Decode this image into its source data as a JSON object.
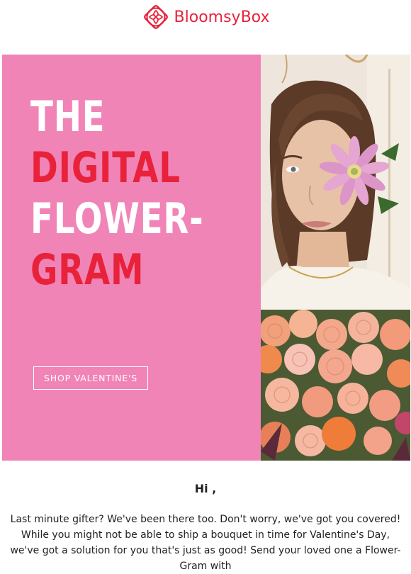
{
  "brand": {
    "name": "BloomsyBox",
    "logo_icon": "flower-knot-icon",
    "color": "#e8223a"
  },
  "hero": {
    "headline": {
      "line1": "THE",
      "line2": "DIGITAL",
      "line3": "FLOWER-",
      "line4": "GRAM"
    },
    "cta_label": "SHOP VALENTINE'S",
    "panel_color": "#f184b6",
    "image_subject": "woman-with-flowers-photo"
  },
  "message": {
    "greeting": "Hi ,",
    "body": "Last minute gifter? We've been there too. Don't worry, we've got you covered! While you might not be able to ship a bouquet in time for Valentine's Day, we've got a solution for you that's just as good! Send your loved one a Flower-Gram with"
  }
}
